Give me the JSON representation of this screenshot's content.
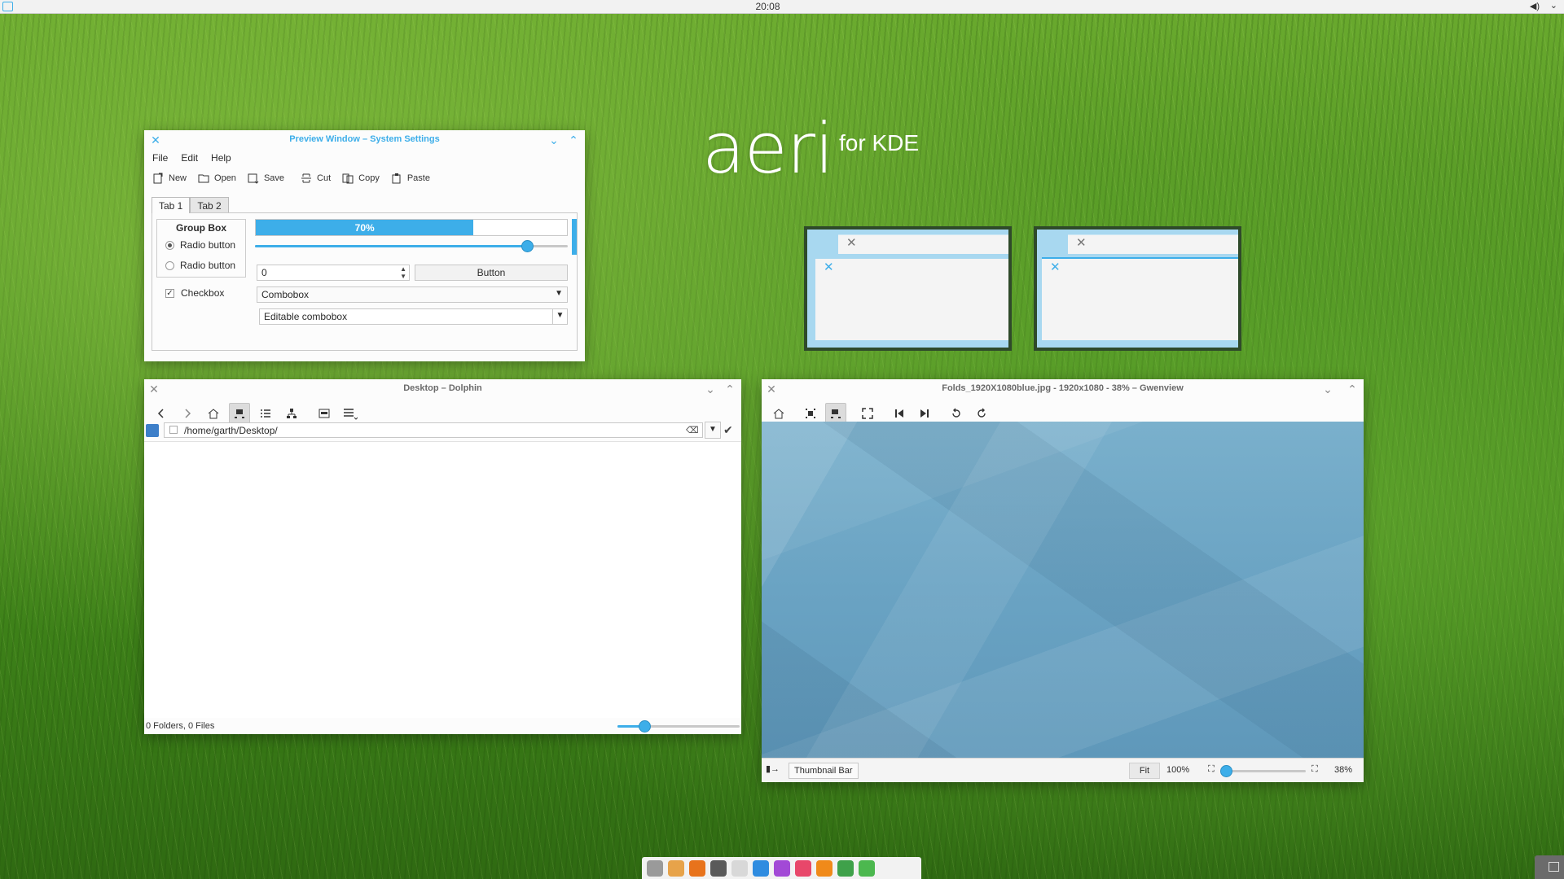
{
  "top_panel": {
    "clock": "20:08"
  },
  "logo": {
    "big": "aeri",
    "small": "for KDE"
  },
  "settings_window": {
    "title": "Preview Window – System Settings",
    "menu": [
      "File",
      "Edit",
      "Help"
    ],
    "toolbar": [
      "New",
      "Open",
      "Save",
      "Cut",
      "Copy",
      "Paste"
    ],
    "tabs": [
      "Tab 1",
      "Tab 2"
    ],
    "group_box_title": "Group Box",
    "radio1": "Radio button",
    "radio2": "Radio button",
    "checkbox": "Checkbox",
    "progress_label": "70%",
    "progress_value": 0.7,
    "slider_value": 0.87,
    "spin_value": "0",
    "button_label": "Button",
    "combobox": "Combobox",
    "editable_combobox": "Editable combobox"
  },
  "dolphin": {
    "title": "Desktop – Dolphin",
    "path": "/home/garth/Desktop/",
    "status": "0 Folders, 0 Files",
    "zoom_value": 0.22
  },
  "gwenview": {
    "title": "Folds_1920X1080blue.jpg - 1920x1080 - 38% – Gwenview",
    "thumbnail_bar": "Thumbnail Bar",
    "fit": "Fit",
    "hundred": "100%",
    "zoom_pct": "38%",
    "zoom_value": 0.02
  },
  "colors": {
    "accent": "#3daee9",
    "panel": "#f2f2f2",
    "window": "#fcfcfc"
  },
  "dock_apps": [
    {
      "name": "system-settings",
      "color": "#9a9a9a"
    },
    {
      "name": "file-manager",
      "color": "#e7a34a"
    },
    {
      "name": "firefox",
      "color": "#e8731c"
    },
    {
      "name": "terminal",
      "color": "#5a5a5a"
    },
    {
      "name": "text-editor",
      "color": "#d8d8d8"
    },
    {
      "name": "browser",
      "color": "#2f8ce0"
    },
    {
      "name": "krita",
      "color": "#a249d6"
    },
    {
      "name": "music",
      "color": "#e8476a"
    },
    {
      "name": "vlc",
      "color": "#f08a1a"
    },
    {
      "name": "system-monitor",
      "color": "#3fa14a"
    },
    {
      "name": "android",
      "color": "#4cb84f"
    }
  ]
}
